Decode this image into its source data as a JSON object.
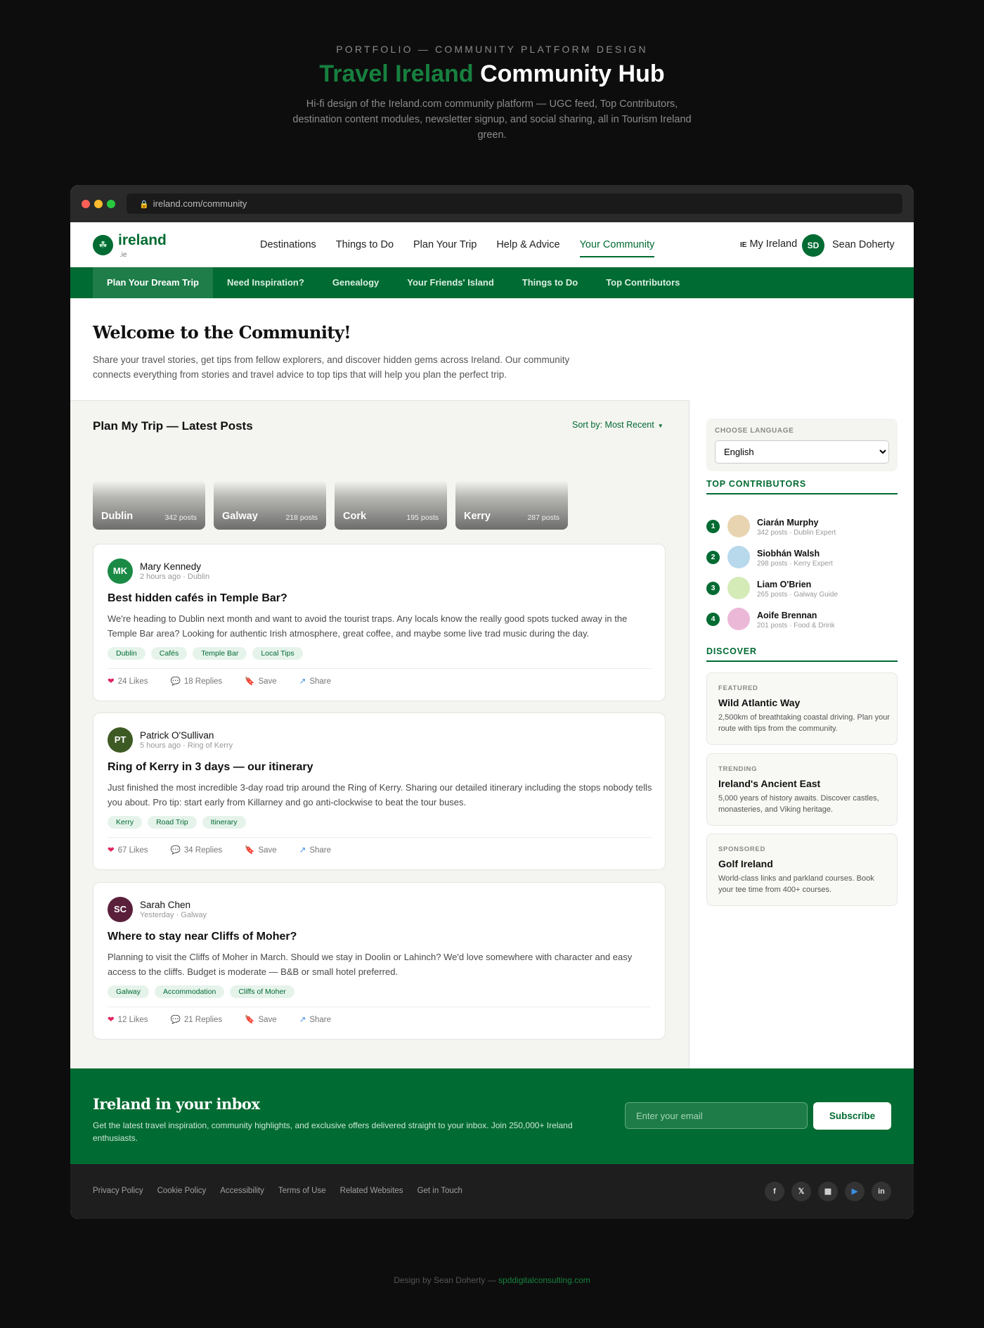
{
  "hero": {
    "eyebrow": "PORTFOLIO — COMMUNITY PLATFORM DESIGN",
    "title_accent": "Travel Ireland",
    "title_rest": "Community Hub",
    "subtitle": "Hi-fi design of the Ireland.com community platform — UGC feed, Top Contributors, destination content modules, newsletter signup, and social sharing, all in Tourism Ireland green."
  },
  "browser": {
    "url": "ireland.com/community"
  },
  "header": {
    "logo": "ireland",
    "logo_sub": ".ie",
    "nav": [
      "Destinations",
      "Things to Do",
      "Plan Your Trip",
      "Help & Advice",
      "Your Community"
    ],
    "my_ireland_prefix": "IE",
    "my_ireland": "My Ireland",
    "user_initials": "SD",
    "user_name": "Sean Doherty"
  },
  "subnav": [
    "Plan Your Dream Trip",
    "Need Inspiration?",
    "Genealogy",
    "Your Friends' Island",
    "Things to Do",
    "Top Contributors"
  ],
  "welcome": {
    "title": "Welcome to the Community!",
    "body": "Share your travel stories, get tips from fellow explorers, and discover hidden gems across Ireland. Our community connects everything from stories and travel advice to top tips that will help you plan the perfect trip."
  },
  "feed": {
    "heading": "Plan My Trip — Latest Posts",
    "sort": "Sort by: Most Recent",
    "destinations": [
      {
        "name": "Dublin",
        "count": "342 posts"
      },
      {
        "name": "Galway",
        "count": "218 posts"
      },
      {
        "name": "Cork",
        "count": "195 posts"
      },
      {
        "name": "Kerry",
        "count": "287 posts"
      }
    ],
    "posts": [
      {
        "initials": "MK",
        "author": "Mary Kennedy",
        "meta": "2 hours ago · Dublin",
        "title": "Best hidden cafés in Temple Bar?",
        "body": "We're heading to Dublin next month and want to avoid the tourist traps. Any locals know the really good spots tucked away in the Temple Bar area? Looking for authentic Irish atmosphere, great coffee, and maybe some live trad music during the day.",
        "tags": [
          "Dublin",
          "Cafés",
          "Temple Bar",
          "Local Tips"
        ],
        "likes": "24 Likes",
        "replies": "18 Replies",
        "save": "Save",
        "share": "Share",
        "color": "#1a8a45"
      },
      {
        "initials": "PT",
        "author": "Patrick O'Sullivan",
        "meta": "5 hours ago · Ring of Kerry",
        "title": "Ring of Kerry in 3 days — our itinerary",
        "body": "Just finished the most incredible 3-day road trip around the Ring of Kerry. Sharing our detailed itinerary including the stops nobody tells you about. Pro tip: start early from Killarney and go anti-clockwise to beat the tour buses.",
        "tags": [
          "Kerry",
          "Road Trip",
          "Itinerary"
        ],
        "likes": "67 Likes",
        "replies": "34 Replies",
        "save": "Save",
        "share": "Share",
        "color": "#3d5a24"
      },
      {
        "initials": "SC",
        "author": "Sarah Chen",
        "meta": "Yesterday · Galway",
        "title": "Where to stay near Cliffs of Moher?",
        "body": "Planning to visit the Cliffs of Moher in March. Should we stay in Doolin or Lahinch? We'd love somewhere with character and easy access to the cliffs. Budget is moderate — B&B or small hotel preferred.",
        "tags": [
          "Galway",
          "Accommodation",
          "Cliffs of Moher"
        ],
        "likes": "12 Likes",
        "replies": "21 Replies",
        "save": "Save",
        "share": "Share",
        "color": "#5a1f3a"
      }
    ]
  },
  "sidebar": {
    "language_label": "CHOOSE LANGUAGE",
    "language_value": "English",
    "contributors_heading": "TOP CONTRIBUTORS",
    "contributors": [
      {
        "rank": "1",
        "name": "Ciarán Murphy",
        "meta": "342 posts · Dublin Expert",
        "color": "#e8d4b0"
      },
      {
        "rank": "2",
        "name": "Siobhán Walsh",
        "meta": "298 posts · Kerry Expert",
        "color": "#b8d8ec"
      },
      {
        "rank": "3",
        "name": "Liam O'Brien",
        "meta": "265 posts · Galway Guide",
        "color": "#d4ebb8"
      },
      {
        "rank": "4",
        "name": "Aoife Brennan",
        "meta": "201 posts · Food & Drink",
        "color": "#ecb8d8"
      }
    ],
    "discover_heading": "DISCOVER",
    "cards": [
      {
        "kicker": "FEATURED",
        "title": "Wild Atlantic Way",
        "desc": "2,500km of breathtaking coastal driving. Plan your route with tips from the community."
      },
      {
        "kicker": "TRENDING",
        "title": "Ireland's Ancient East",
        "desc": "5,000 years of history awaits. Discover castles, monasteries, and Viking heritage."
      },
      {
        "kicker": "SPONSORED",
        "title": "Golf Ireland",
        "desc": "World-class links and parkland courses. Book your tee time from 400+ courses."
      }
    ]
  },
  "newsletter": {
    "title": "Ireland in your inbox",
    "body": "Get the latest travel inspiration, community highlights, and exclusive offers delivered straight to your inbox. Join 250,000+ Ireland enthusiasts.",
    "placeholder": "Enter your email",
    "button": "Subscribe"
  },
  "footer": {
    "links": [
      "Privacy Policy",
      "Cookie Policy",
      "Accessibility",
      "Terms of Use",
      "Related Websites",
      "Get in Touch"
    ],
    "social": [
      "f",
      "𝕏",
      "▦",
      "▶",
      "in"
    ]
  },
  "credit": {
    "prefix": "Design by Sean Doherty —",
    "link": "spddigitalconsulting.com"
  },
  "colors": {
    "brand_green": "#006b32",
    "accent_green": "#17803f"
  }
}
